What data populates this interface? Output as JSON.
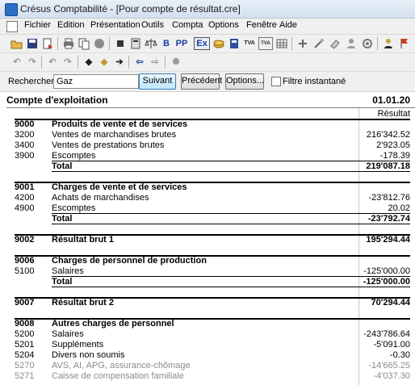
{
  "window": {
    "title": "Crésus Comptabilité - [Pour compte de résultat.cre]"
  },
  "menu": [
    "Fichier",
    "Edition",
    "Présentation",
    "Outils",
    "Compta",
    "Options",
    "Fenêtre",
    "Aide"
  ],
  "toolbar1": {
    "buttons": [
      "open-icon",
      "save-icon",
      "export-icon",
      "print-icon",
      "copy-icon",
      "record-icon",
      "stop-icon",
      "calc-icon",
      "scale-icon",
      "bold-b-icon",
      "pp-icon",
      "ex-icon",
      "coins-icon",
      "book-icon",
      "tva-icon",
      "tva-ca-icon",
      "grid-icon",
      "add-icon",
      "wand-icon",
      "eraser-icon",
      "people-icon",
      "gear-icon",
      "user-icon",
      "flag-icon"
    ],
    "labels": {
      "b": "B",
      "pp": "PP",
      "ex": "Ex",
      "tva": "TVA",
      "tvaca": "TVA"
    }
  },
  "toolbar2": {
    "buttons": [
      "undo-icon",
      "redo-icon",
      "undo2-icon",
      "redo2-icon",
      "back-icon",
      "goto-icon",
      "forward-icon",
      "left-icon",
      "right-icon",
      "filter-icon"
    ]
  },
  "search": {
    "label": "Rechercher :",
    "value": "Gaz",
    "next_label": "Suivant",
    "prev_label": "Précédent",
    "options_label": "Options...",
    "instant_label": "Filtre instantané"
  },
  "report": {
    "title": "Compte d'exploitation",
    "date": "01.01.20",
    "column": "Résultat",
    "rows": [
      {
        "acct": "9000",
        "label": "Produits de vente et de services",
        "value": "",
        "style": "bold"
      },
      {
        "acct": "3200",
        "label": "Ventes de marchandises brutes",
        "value": "216'342.52",
        "style": ""
      },
      {
        "acct": "3400",
        "label": "Ventes de prestations brutes",
        "value": "2'923.05",
        "style": ""
      },
      {
        "acct": "3900",
        "label": "Escomptes",
        "value": "-178.39",
        "style": ""
      },
      {
        "acct": "",
        "label": "Total",
        "value": "219'087.18",
        "style": "bold"
      },
      {
        "acct": "9001",
        "label": "Charges de vente et de services",
        "value": "",
        "style": "bold"
      },
      {
        "acct": "4200",
        "label": "Achats de marchandises",
        "value": "-23'812.76",
        "style": ""
      },
      {
        "acct": "4900",
        "label": "Escomptes",
        "value": "20.02",
        "style": ""
      },
      {
        "acct": "",
        "label": "Total",
        "value": "-23'792.74",
        "style": "bold"
      },
      {
        "acct": "9002",
        "label": "Résultat brut 1",
        "value": "195'294.44",
        "style": "bold"
      },
      {
        "acct": "9006",
        "label": "Charges de personnel de production",
        "value": "",
        "style": "bold"
      },
      {
        "acct": "5100",
        "label": "Salaires",
        "value": "-125'000.00",
        "style": ""
      },
      {
        "acct": "",
        "label": "Total",
        "value": "-125'000.00",
        "style": "bold"
      },
      {
        "acct": "9007",
        "label": "Résultat brut 2",
        "value": "70'294.44",
        "style": "bold"
      },
      {
        "acct": "9008",
        "label": "Autres charges de personnel",
        "value": "",
        "style": "bold"
      },
      {
        "acct": "5200",
        "label": "Salaires",
        "value": "-243'786.64",
        "style": ""
      },
      {
        "acct": "5201",
        "label": "Suppléments",
        "value": "-5'091.00",
        "style": ""
      },
      {
        "acct": "5204",
        "label": "Divers non soumis",
        "value": "-0.30",
        "style": ""
      },
      {
        "acct": "5270",
        "label": "AVS, AI, APG, assurance-chômage",
        "value": "-14'665.25",
        "style": "dim"
      },
      {
        "acct": "5271",
        "label": "Caisse de compensation familiale",
        "value": "-4'037.30",
        "style": "dim"
      }
    ]
  }
}
